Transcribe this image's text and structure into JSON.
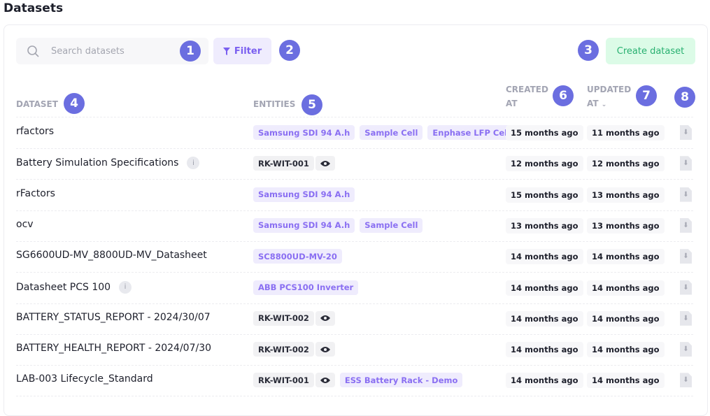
{
  "page_title": "Datasets",
  "search": {
    "placeholder": "Search datasets"
  },
  "filter_label": "Filter",
  "create_label": "Create dataset",
  "markers": [
    "1",
    "2",
    "3",
    "4",
    "5",
    "6",
    "7",
    "8"
  ],
  "columns": {
    "dataset": "DATASET",
    "entities": "ENTITIES",
    "created_1": "CREATED",
    "created_2": "AT",
    "updated_1": "UPDATED",
    "updated_2": "AT"
  },
  "rows": [
    {
      "name": "rfactors",
      "info": false,
      "entities": [
        {
          "label": "Samsung SDI 94 A.h",
          "type": "p"
        },
        {
          "label": "Sample Cell",
          "type": "p"
        },
        {
          "label": "Enphase LFP Cell",
          "type": "p"
        }
      ],
      "created": "15 months ago",
      "updated": "11 months ago"
    },
    {
      "name": "Battery Simulation Specifications",
      "info": true,
      "entities": [
        {
          "label": "RK-WIT-001",
          "type": "g",
          "eye": true
        }
      ],
      "created": "12 months ago",
      "updated": "12 months ago"
    },
    {
      "name": "rFactors",
      "info": false,
      "entities": [
        {
          "label": "Samsung SDI 94 A.h",
          "type": "p"
        }
      ],
      "created": "15 months ago",
      "updated": "13 months ago"
    },
    {
      "name": "ocv",
      "info": false,
      "entities": [
        {
          "label": "Samsung SDI 94 A.h",
          "type": "p"
        },
        {
          "label": "Sample Cell",
          "type": "p"
        }
      ],
      "created": "13 months ago",
      "updated": "13 months ago"
    },
    {
      "name": "SG6600UD-MV_8800UD-MV_Datasheet",
      "info": false,
      "entities": [
        {
          "label": "SC8800UD-MV-20",
          "type": "p"
        }
      ],
      "created": "14 months ago",
      "updated": "14 months ago"
    },
    {
      "name": "Datasheet PCS 100",
      "info": true,
      "entities": [
        {
          "label": "ABB PCS100 Inverter",
          "type": "p"
        }
      ],
      "created": "14 months ago",
      "updated": "14 months ago"
    },
    {
      "name": "BATTERY_STATUS_REPORT - 2024/30/07",
      "info": false,
      "entities": [
        {
          "label": "RK-WIT-002",
          "type": "g",
          "eye": true
        }
      ],
      "created": "14 months ago",
      "updated": "14 months ago"
    },
    {
      "name": "BATTERY_HEALTH_REPORT - 2024/07/30",
      "info": false,
      "entities": [
        {
          "label": "RK-WIT-002",
          "type": "g",
          "eye": true
        }
      ],
      "created": "14 months ago",
      "updated": "14 months ago"
    },
    {
      "name": "LAB-003 Lifecycle_Standard",
      "info": false,
      "entities": [
        {
          "label": "RK-WIT-001",
          "type": "g",
          "eye": true
        },
        {
          "label": "ESS Battery Rack - Demo",
          "type": "p"
        }
      ],
      "created": "14 months ago",
      "updated": "14 months ago"
    }
  ]
}
